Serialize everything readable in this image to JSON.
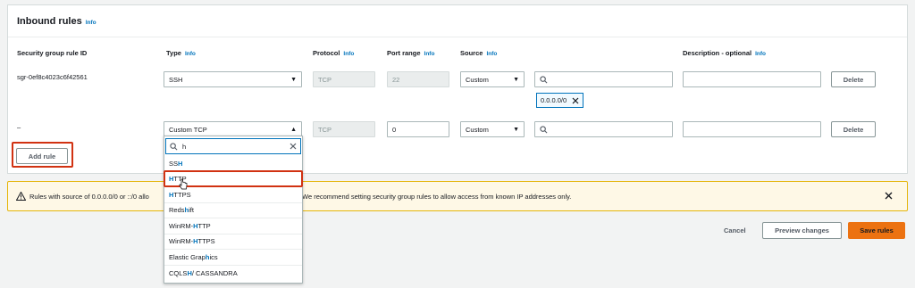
{
  "header": {
    "title": "Inbound rules",
    "info": "Info"
  },
  "columns": {
    "rule_id": "Security group rule ID",
    "type": "Type",
    "type_info": "Info",
    "protocol": "Protocol",
    "protocol_info": "Info",
    "port_range": "Port range",
    "port_range_info": "Info",
    "source": "Source",
    "source_info": "Info",
    "description": "Description - optional",
    "description_info": "Info"
  },
  "rows": [
    {
      "rule_id": "sgr-0ef8c4023c6f42561",
      "type": "SSH",
      "protocol": "TCP",
      "port": "22",
      "source": "Custom",
      "search": "",
      "token": "0.0.0.0/0",
      "description": "",
      "delete": "Delete"
    },
    {
      "rule_id": "–",
      "type": "Custom TCP",
      "protocol": "TCP",
      "port": "0",
      "source": "Custom",
      "search": "",
      "description": "",
      "delete": "Delete"
    }
  ],
  "add_rule": "Add rule",
  "type_dropdown": {
    "filter_value": "h",
    "options": [
      {
        "pre": "SS",
        "hl": "H",
        "post": ""
      },
      {
        "pre": "",
        "hl": "H",
        "post": "TTP"
      },
      {
        "pre": "",
        "hl": "H",
        "post": "TTPS"
      },
      {
        "pre": "Reds",
        "hl": "h",
        "post": "ift"
      },
      {
        "pre": "WinRM-",
        "hl": "H",
        "post": "TTP"
      },
      {
        "pre": "WinRM-",
        "hl": "H",
        "post": "TTPS"
      },
      {
        "pre": "Elastic Grap",
        "hl": "h",
        "post": "ics"
      },
      {
        "pre": "CQLS",
        "hl": "H",
        "post": " / CASSANDRA"
      }
    ]
  },
  "banner": {
    "text_left": "Rules with source of 0.0.0.0/0 or ::/0 allo",
    "text_right": "We recommend setting security group rules to allow access from known IP addresses only."
  },
  "footer": {
    "cancel": "Cancel",
    "preview": "Preview changes",
    "save": "Save rules"
  },
  "colors": {
    "accent": "#ec7211",
    "link": "#0073bb",
    "highlight": "#d13212",
    "warning": "#e5b50b"
  }
}
